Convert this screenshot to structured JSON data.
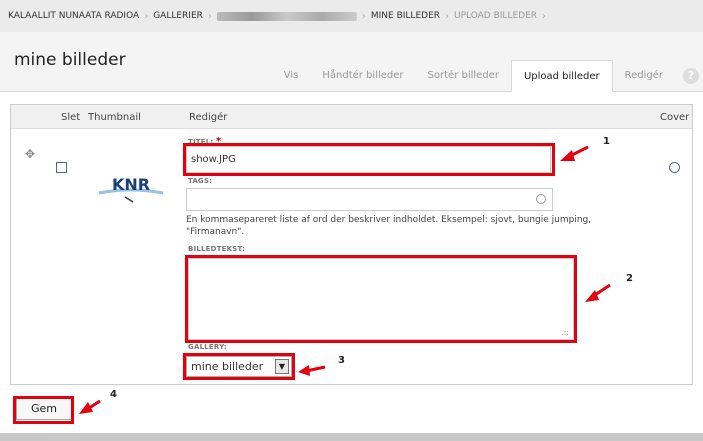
{
  "breadcrumb": {
    "items": [
      "KALAALLIT NUNAATA RADIOA",
      "GALLERIER",
      "MINE BILLEDER",
      "UPLOAD BILLEDER"
    ],
    "separator": "›"
  },
  "header": {
    "title": "mine billeder",
    "tabs": [
      {
        "label": "Vis"
      },
      {
        "label": "Håndtér billeder"
      },
      {
        "label": "Sortér billeder"
      },
      {
        "label": "Upload billeder"
      },
      {
        "label": "Redigér"
      }
    ],
    "help": "?"
  },
  "table": {
    "headers": {
      "delete": "Slet",
      "thumbnail": "Thumbnail",
      "edit": "Redigér",
      "cover": "Cover"
    },
    "row": {
      "thumbnail_text": "KNR",
      "title_label": "TITEL:",
      "required_mark": "*",
      "title_value": "show.JPG",
      "tags_label": "TAGS:",
      "tags_value": "",
      "tags_help": "En kommasepareret liste af ord der beskriver indholdet. Eksempel: sjovt, bungie jumping, \"Firmanavn\".",
      "caption_label": "BILLEDTEKST:",
      "caption_value": "",
      "gallery_label": "GALLERY:",
      "gallery_value": "mine billeder"
    }
  },
  "footer": {
    "save_label": "Gem"
  },
  "annotations": {
    "callouts": [
      "1",
      "2",
      "3",
      "4"
    ],
    "color": "#e3000f"
  }
}
